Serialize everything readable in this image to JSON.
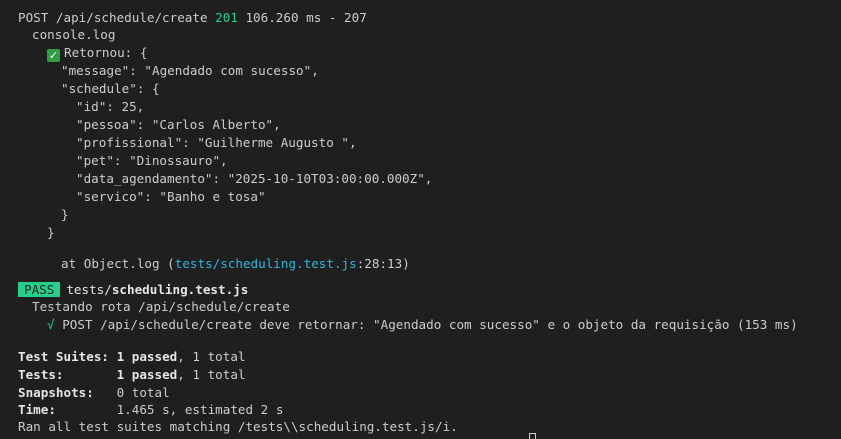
{
  "request_log": {
    "method_path": "POST /api/schedule/create ",
    "status": "201",
    "rest": " 106.260 ms - 207"
  },
  "console_label": "console.log",
  "returned": {
    "icon": "check-mark-button",
    "check_glyph": "✓",
    "label": "Retornou: {",
    "lines": [
      "\"message\": \"Agendado com sucesso\",",
      "\"schedule\": {",
      "\"id\": 25,",
      "\"pessoa\": \"Carlos Alberto\",",
      "\"profissional\": \"Guilherme Augusto \",",
      "\"pet\": \"Dinossauro\",",
      "\"data_agendamento\": \"2025-10-10T03:00:00.000Z\",",
      "\"servico\": \"Banho e tosa\"",
      "}",
      "}"
    ]
  },
  "stack": {
    "prefix": "at Object.log (",
    "file": "tests/scheduling.test.js",
    "suffix": ":28:13)"
  },
  "pass_result": {
    "badge": "PASS",
    "path_prefix": "tests/",
    "file": "scheduling.test.js",
    "describe": "Testando rota /api/schedule/create",
    "test_check": "√",
    "test_name": "POST /api/schedule/create deve retornar: \"Agendado com sucesso\" e o objeto da requisição (153 ms)"
  },
  "summary": {
    "suites_label": "Test Suites:",
    "suites_passed": "1 passed",
    "suites_total": ", 1 total",
    "tests_label": "Tests:",
    "tests_passed": "1 passed",
    "tests_total": ", 1 total",
    "snapshots_label": "Snapshots:",
    "snapshots_value": "0 total",
    "time_label": "Time:",
    "time_value": "1.465 s, estimated 2 s",
    "ran_all": "Ran all test suites matching /tests\\\\scheduling.test.js/i."
  },
  "colors": {
    "background": "#1f1f1f",
    "text": "#cccccc",
    "green": "#23d18b",
    "link_blue": "#29b8db"
  }
}
